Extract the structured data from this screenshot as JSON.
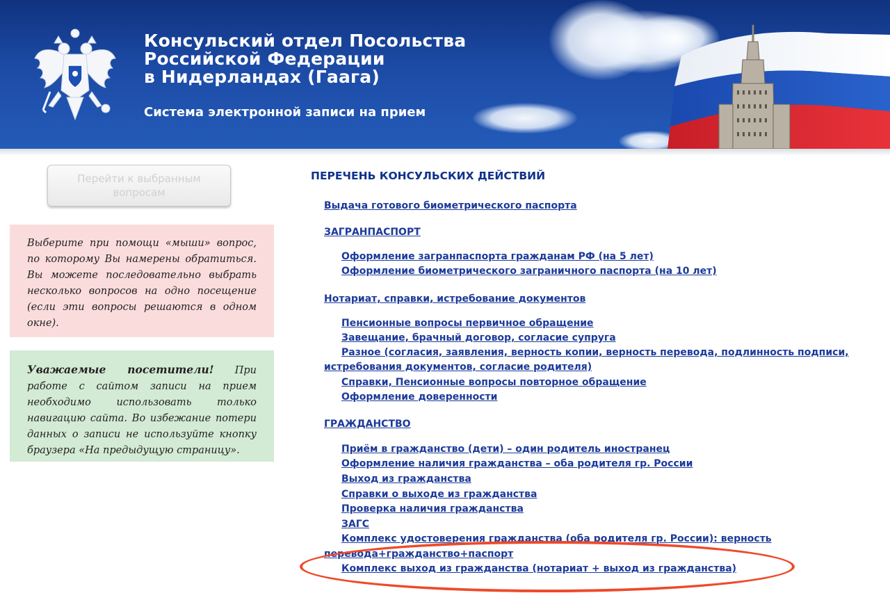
{
  "header": {
    "title_lines": [
      "Консульский отдел Посольства",
      "Российской Федерации",
      "в Нидерландах (Гаага)"
    ],
    "subtitle": "Система электронной записи на прием",
    "flag_colors": [
      "#ffffff",
      "#1d4fb4",
      "#d9232d"
    ]
  },
  "sidebar": {
    "goto_button": "Перейти к выбранным вопросам",
    "notice_select": "Выберите при помощи «мыши» вопрос, по которому Вы намерены обратиться. Вы можете последовательно выбрать несколько вопросов на одно посещение (если эти вопросы решаются в одном окне).",
    "notice_visitors_bold": "Уважаемые посетители!",
    "notice_visitors_text": " При работе с сайтом записи на прием необходимо использовать только навигацию сайта. Во избежание потери данных о записи не используйте кнопку браузера «На предыдущую страницу»."
  },
  "main": {
    "title": "ПЕРЕЧЕНЬ КОНСУЛЬСКИХ ДЕЙСТВИЙ",
    "passport_pickup": "Выдача готового биометрического паспорта",
    "zagran": {
      "label": "ЗАГРАНПАСПОРТ",
      "items": [
        "Оформление загранпаспорта гражданам РФ (на 5 лет)",
        "Оформление биометрического заграничного паспорта (на 10 лет)"
      ]
    },
    "notary": {
      "label": "Нотариат, справки, истребование документов",
      "items": [
        "Пенсионные вопросы первичное обращение",
        "Завещание, брачный договор, согласие супруга",
        "Разное (согласия, заявления, верность копии, верность перевода, подлинность подписи,",
        "истребования документов, согласие родителя)",
        "Справки, Пенсионные вопросы повторное обращение",
        "Оформление доверенности"
      ]
    },
    "citizenship": {
      "label": "ГРАЖДАНСТВО",
      "items": [
        "Приём в гражданство (дети) – один родитель иностранец",
        "Оформление наличия гражданства – оба родителя гр. России",
        "Выход из гражданства",
        "Справки о выходе из гражданства",
        "Проверка наличия гражданства",
        "ЗАГС",
        "Комплекс удостоверения гражданства (оба родителя гр. России): верность",
        "перевода+гражданство+паспорт",
        "Комплекс выход из гражданства (нотариат + выход из гражданства)"
      ]
    },
    "highlight_color": "#ee4a2a"
  }
}
